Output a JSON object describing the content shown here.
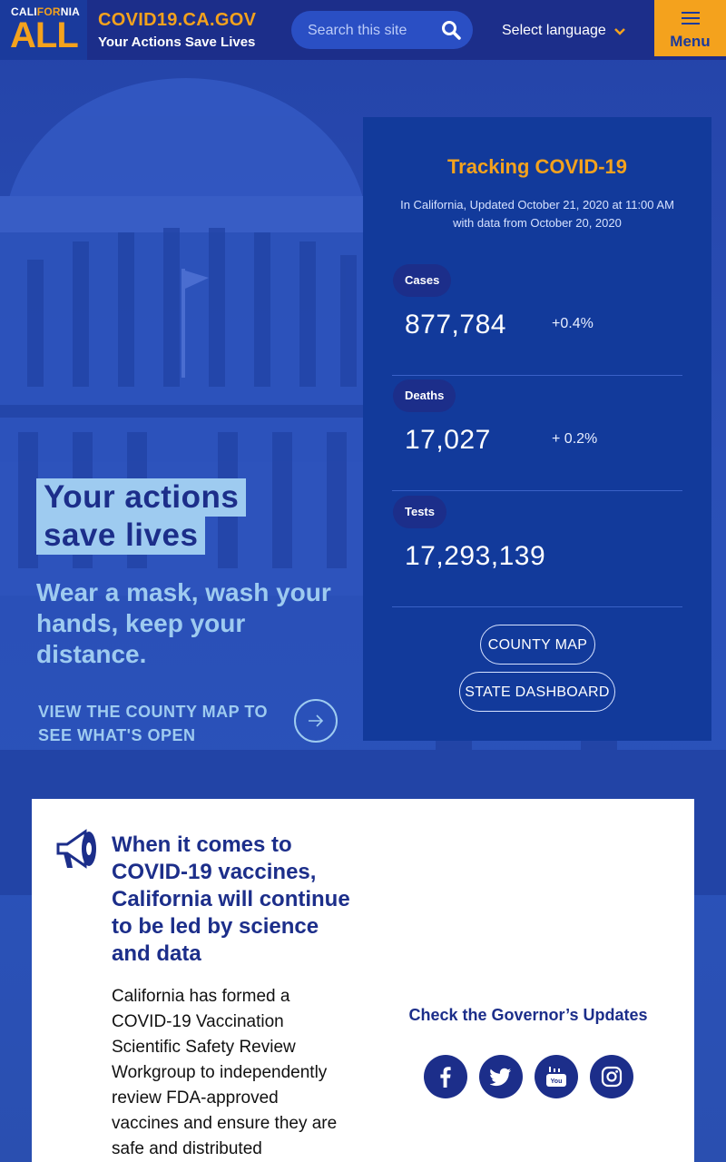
{
  "header": {
    "logo_top": "CALI",
    "logo_for": "FOR",
    "logo_nia": "NIA",
    "logo_all": "ALL",
    "site_name": "COVID19.CA.GOV",
    "site_tagline": "Your Actions Save Lives",
    "search_placeholder": "Search this site",
    "language_label": "Select language",
    "menu_label": "Menu"
  },
  "hero": {
    "title_line1": "Your actions",
    "title_line2": "save lives",
    "subtitle": "Wear a mask, wash your hands, keep your distance.",
    "link_text": "VIEW THE COUNTY MAP TO SEE WHAT'S OPEN"
  },
  "tracking": {
    "title": "Tracking COVID-19",
    "updated": "In California, Updated October 21, 2020 at 11:00 AM with data from October 20, 2020",
    "stats": [
      {
        "label": "Cases",
        "value": "877,784",
        "change": "+0.4%"
      },
      {
        "label": "Deaths",
        "value": "17,027",
        "change": "+ 0.2%"
      },
      {
        "label": "Tests",
        "value": "17,293,139",
        "change": ""
      }
    ],
    "county_map_label": "COUNTY MAP",
    "dashboard_label": "STATE DASHBOARD"
  },
  "vaccine": {
    "heading": "When it comes to COVID-19 vaccines, California will continue to be led by science and data",
    "body": "California has formed a COVID-19 Vaccination Scientific Safety Review Workgroup to independently review FDA-approved vaccines and ensure they are safe and distributed"
  },
  "governor": {
    "heading": "Check the Governor’s Updates",
    "socials": [
      "facebook-icon",
      "twitter-icon",
      "youtube-icon",
      "instagram-icon"
    ]
  },
  "colors": {
    "brand_blue": "#1c2e8a",
    "accent_orange": "#f4a21d",
    "light_blue": "#9ecbf0",
    "card_blue": "#123a9b"
  }
}
